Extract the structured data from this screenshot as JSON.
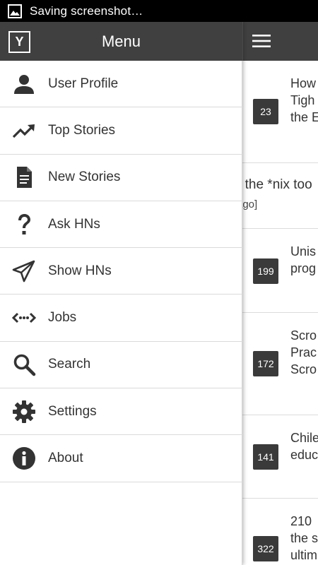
{
  "status_bar": {
    "text": "Saving screenshot…",
    "icon": "image-icon"
  },
  "drawer": {
    "logo": "Y",
    "title": "Menu",
    "items": [
      {
        "label": "User Profile",
        "icon": "user-icon"
      },
      {
        "label": "Top Stories",
        "icon": "trending-up-icon"
      },
      {
        "label": "New Stories",
        "icon": "document-icon"
      },
      {
        "label": "Ask HNs",
        "icon": "question-icon"
      },
      {
        "label": "Show HNs",
        "icon": "send-icon"
      },
      {
        "label": "Jobs",
        "icon": "code-arrows-icon"
      },
      {
        "label": "Search",
        "icon": "search-icon"
      },
      {
        "label": "Settings",
        "icon": "gear-icon"
      },
      {
        "label": "About",
        "icon": "info-icon"
      }
    ]
  },
  "stories": {
    "visible": [
      {
        "score": "23",
        "title": "How\nTigh\nthe E"
      },
      {
        "text_line1": "- the *nix too",
        "text_line2": "ago]"
      },
      {
        "score": "199",
        "title": "Unis\nprog"
      },
      {
        "score": "172",
        "title": "Scro\nPrac\nScro"
      },
      {
        "score": "141",
        "title": "Chile\neduc"
      },
      {
        "score": "322",
        "title": "210\nthe s\nultim"
      }
    ]
  }
}
